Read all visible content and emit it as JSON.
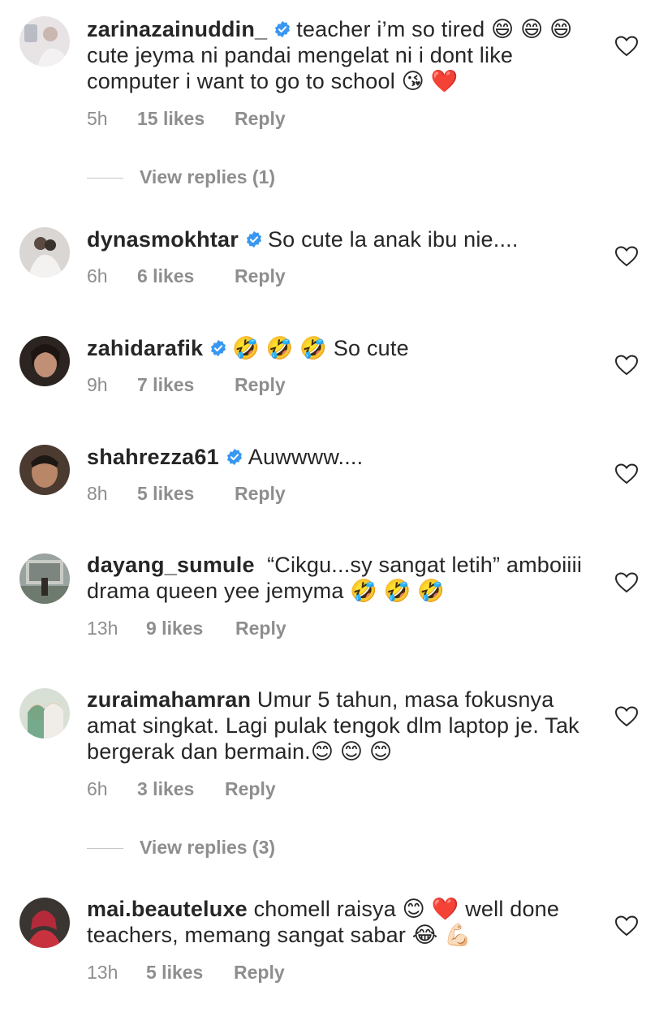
{
  "comments": [
    {
      "username": "zarinazainuddin_",
      "verified": true,
      "text": "teacher i’m so tired 😄 😄 😄  cute jeyma ni pandai mengelat ni i dont like computer i want to go to school 😘 ❤️",
      "time": "5h",
      "likes": "15 likes",
      "reply": "Reply",
      "view_replies": "View replies (1)"
    },
    {
      "username": "dynasmokhtar",
      "verified": true,
      "text": "So cute la anak ibu nie....",
      "time": "6h",
      "likes": "6 likes",
      "reply": "Reply"
    },
    {
      "username": "zahidarafik",
      "verified": true,
      "text": "🤣 🤣 🤣  So cute",
      "time": "9h",
      "likes": "7 likes",
      "reply": "Reply"
    },
    {
      "username": "shahrezza61",
      "verified": true,
      "text": "Auwwww....",
      "time": "8h",
      "likes": "5 likes",
      "reply": "Reply"
    },
    {
      "username": "dayang_sumule",
      "verified": false,
      "text": "“Cikgu...sy sangat letih” amboiiii drama queen yee jemyma 🤣 🤣 🤣",
      "time": "13h",
      "likes": "9 likes",
      "reply": "Reply"
    },
    {
      "username": "zuraimahamran",
      "verified": false,
      "text": "Umur 5 tahun, masa fokusnya amat singkat. Lagi pulak tengok dlm laptop je. Tak bergerak dan bermain.😊 😊 😊",
      "time": "6h",
      "likes": "3 likes",
      "reply": "Reply",
      "view_replies": "View replies (3)"
    },
    {
      "username": "mai.beauteluxe",
      "verified": false,
      "text": "chomell raisya 😊 ❤️ well done teachers, memang sangat sabar 😂 💪🏻",
      "time": "13h",
      "likes": "5 likes",
      "reply": "Reply"
    }
  ],
  "colors": {
    "text": "#262626",
    "secondary": "#8e8e8e",
    "verified": "#3897f0"
  },
  "icons": {
    "verified": "verified-badge-icon",
    "like": "heart-outline-icon"
  }
}
